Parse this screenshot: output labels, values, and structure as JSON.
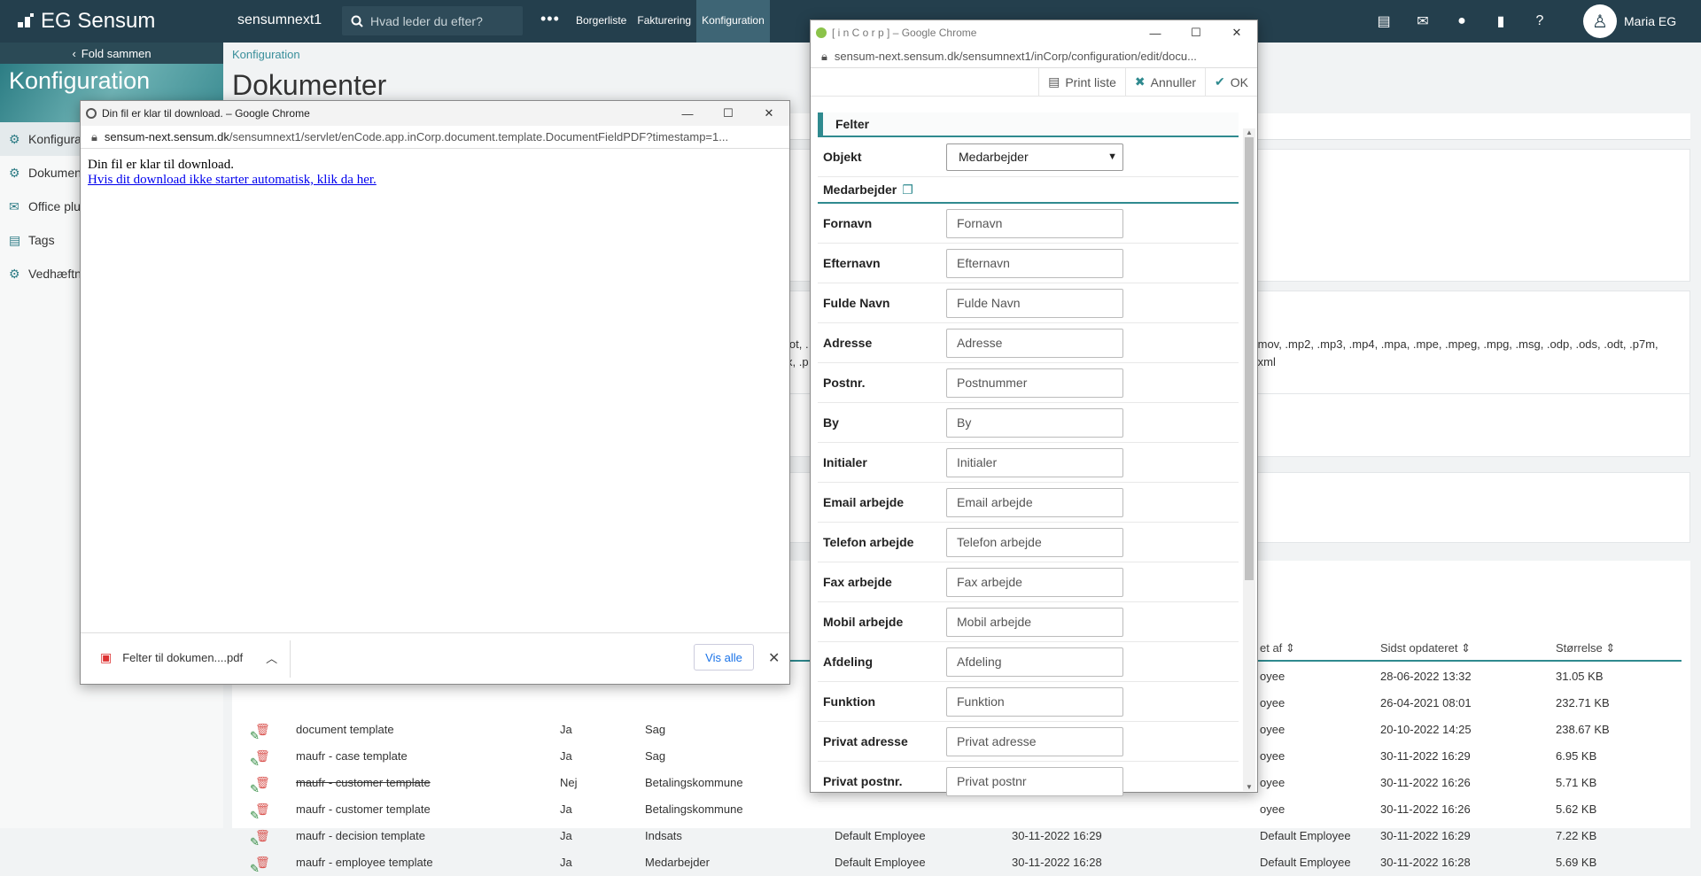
{
  "topbar": {
    "logo_text": "EG Sensum",
    "org": "sensumnext1",
    "search_placeholder": "Hvad leder du efter?",
    "nav": [
      "Borgerliste",
      "Fakturering",
      "Konfiguration"
    ],
    "user": "Maria EG"
  },
  "sidebar": {
    "fold_label": "Fold sammen",
    "title": "Konfiguration",
    "items": [
      {
        "label": "Konfigura"
      },
      {
        "label": "Dokumen"
      },
      {
        "label": "Office plu"
      },
      {
        "label": "Tags"
      },
      {
        "label": "Vedhæftn"
      }
    ]
  },
  "main": {
    "breadcrumb": "Konfiguration",
    "title": "Dokumenter",
    "ext_fragments": [
      "lot, .",
      "x, .p",
      ".mov, .mp2, .mp3, .mp4, .mpa, .mpe, .mpeg, .mpg, .msg, .odp, .ods, .odt, .p7m,",
      ".xml"
    ],
    "table": {
      "headers": [
        "et af",
        "Sidst opdateret",
        "Størrelse"
      ],
      "rows": [
        {
          "name": "",
          "active": "",
          "type": "",
          "c1": "",
          "c2": "",
          "c3": "oyee",
          "updated": "28-06-2022 13:32",
          "size": "31.05 KB"
        },
        {
          "name": "",
          "active": "",
          "type": "",
          "c1": "",
          "c2": "",
          "c3": "oyee",
          "updated": "26-04-2021 08:01",
          "size": "232.71 KB"
        },
        {
          "name": "document template",
          "active": "Ja",
          "type": "Sag",
          "c1": "",
          "c2": "",
          "c3": "oyee",
          "updated": "20-10-2022 14:25",
          "size": "238.67 KB"
        },
        {
          "name": "maufr - case template",
          "active": "Ja",
          "type": "Sag",
          "c1": "",
          "c2": "",
          "c3": "oyee",
          "updated": "30-11-2022 16:29",
          "size": "6.95 KB"
        },
        {
          "name": "maufr - customer template",
          "active": "Nej",
          "type": "Betalingskommune",
          "c1": "",
          "c2": "",
          "c3": "oyee",
          "updated": "30-11-2022 16:26",
          "size": "5.71 KB",
          "strike": true
        },
        {
          "name": "maufr - customer template",
          "active": "Ja",
          "type": "Betalingskommune",
          "c1": "",
          "c2": "",
          "c3": "oyee",
          "updated": "30-11-2022 16:26",
          "size": "5.62 KB"
        },
        {
          "name": "maufr - decision template",
          "active": "Ja",
          "type": "Indsats",
          "c1": "Default Employee",
          "c2": "30-11-2022 16:29",
          "c3": "Default Employee",
          "updated": "30-11-2022 16:29",
          "size": "7.22 KB"
        },
        {
          "name": "maufr - employee template",
          "active": "Ja",
          "type": "Medarbejder",
          "c1": "Default Employee",
          "c2": "30-11-2022 16:28",
          "c3": "Default Employee",
          "updated": "30-11-2022 16:28",
          "size": "5.69 KB"
        }
      ]
    }
  },
  "download_window": {
    "title": "Din fil er klar til download. – Google Chrome",
    "url_host": "sensum-next.sensum.dk",
    "url_path": "/sensumnext1/servlet/enCode.app.inCorp.document.template.DocumentFieldPDF?timestamp=1...",
    "message": "Din fil er klar til download.",
    "link": "Hvis dit download ikke starter automatisk, klik da her.",
    "file_name": "Felter til dokumen....pdf",
    "show_all": "Vis alle"
  },
  "incorp_window": {
    "title": "[ i n C o r p ] – Google Chrome",
    "url": "sensum-next.sensum.dk/sensumnext1/inCorp/configuration/edit/docu...",
    "toolbar": {
      "print": "Print liste",
      "cancel": "Annuller",
      "ok": "OK"
    },
    "section": "Felter",
    "object_label": "Objekt",
    "object_value": "Medarbejder",
    "subsection": "Medarbejder",
    "fields": [
      {
        "label": "Fornavn",
        "value": "Fornavn"
      },
      {
        "label": "Efternavn",
        "value": "Efternavn"
      },
      {
        "label": "Fulde Navn",
        "value": "Fulde Navn"
      },
      {
        "label": "Adresse",
        "value": "Adresse"
      },
      {
        "label": "Postnr.",
        "value": "Postnummer"
      },
      {
        "label": "By",
        "value": "By"
      },
      {
        "label": "Initialer",
        "value": "Initialer"
      },
      {
        "label": "Email arbejde",
        "value": "Email arbejde"
      },
      {
        "label": "Telefon arbejde",
        "value": "Telefon arbejde"
      },
      {
        "label": "Fax arbejde",
        "value": "Fax arbejde"
      },
      {
        "label": "Mobil arbejde",
        "value": "Mobil arbejde"
      },
      {
        "label": "Afdeling",
        "value": "Afdeling"
      },
      {
        "label": "Funktion",
        "value": "Funktion"
      },
      {
        "label": "Privat adresse",
        "value": "Privat adresse"
      },
      {
        "label": "Privat postnr.",
        "value": "Privat postnr"
      }
    ]
  }
}
